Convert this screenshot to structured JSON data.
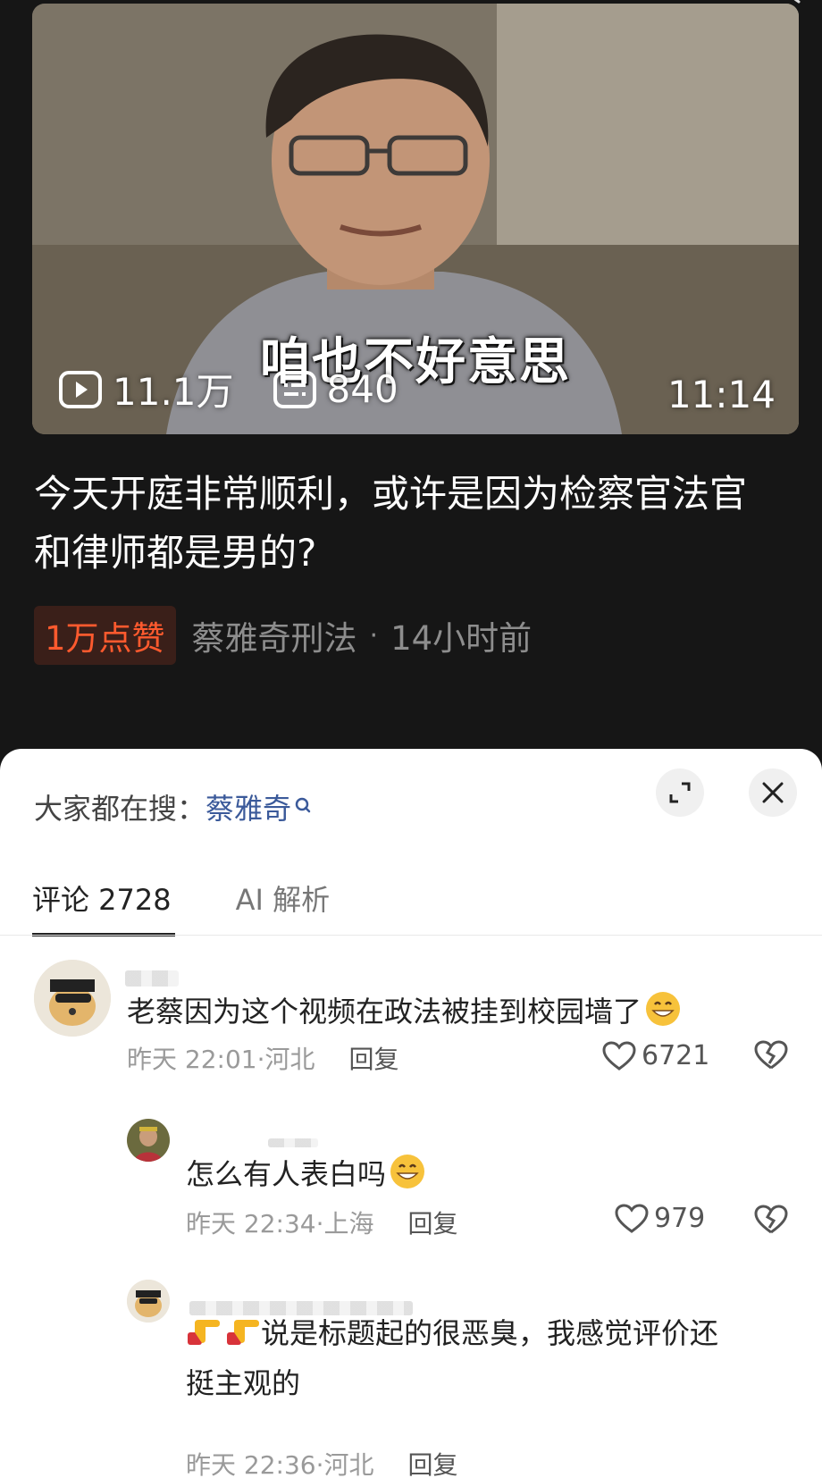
{
  "video": {
    "caption": "咱也不好意思",
    "plays": "11.1万",
    "danmaku": "840",
    "duration": "11:14",
    "title": "今天开庭非常顺利，或许是因为检察官法官和律师都是男的?",
    "likes_badge": "1万点赞",
    "author": "蔡雅奇刑法",
    "separator": "·",
    "time_ago": "14小时前"
  },
  "sheet": {
    "search_prefix": "大家都在搜：",
    "search_keyword": "蔡雅奇",
    "tabs": [
      {
        "label": "评论 2728",
        "active": true
      },
      {
        "label": "AI 解析",
        "active": false
      }
    ]
  },
  "comments": [
    {
      "text": "老蔡因为这个视频在政法被挂到校园墙了",
      "emoji": "grinning-face",
      "meta": "昨天 22:01·河北",
      "reply_label": "回复",
      "likes": "6721"
    },
    {
      "text": "怎么有人表白吗",
      "emoji": "grinning-face",
      "meta": "昨天 22:34·上海",
      "reply_label": "回复",
      "likes": "979"
    },
    {
      "text_line1": "说是标题起的很恶臭，我感觉评价还",
      "text_line2": "挺主观的",
      "emoji": "pointing-hands",
      "meta": "昨天 22:36·河北",
      "reply_label": "回复"
    }
  ],
  "colors": {
    "background": "#161616",
    "like_badge": "#ff5a2e",
    "keyword": "#3b5a9a"
  }
}
